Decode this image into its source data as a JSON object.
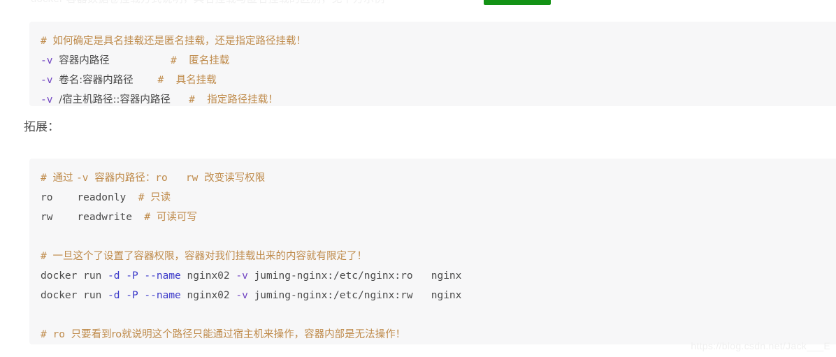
{
  "page": {
    "background_color": "#ffffff",
    "top_clipped_text": "docker 容器数据卷挂载方式说明，具名挂载与匿名挂载的区别，见下方示例",
    "top_green_chip_color": "#139215"
  },
  "colors": {
    "code_background": "#f7f7f8",
    "comment": "#bf8b4b",
    "flag_purple": "#6f42c1",
    "option_blue": "#3b39c9",
    "plain_text": "#4a4a4a",
    "prose_text": "#4f4f4f",
    "watermark": "#f0f0f0"
  },
  "code_block_1": {
    "lines": [
      [
        {
          "text": "# ",
          "type": "comment"
        },
        {
          "text": "如何确定是具名挂载还是匿名挂载，还是指定路径挂载！",
          "type": "comment",
          "cjk": true
        }
      ],
      [
        {
          "text": "-v",
          "type": "flag"
        },
        {
          "text": " ",
          "type": "plain"
        },
        {
          "text": "容器内路径",
          "type": "plain",
          "cjk": true
        },
        {
          "text": "          ",
          "type": "plain"
        },
        {
          "text": "#  ",
          "type": "comment"
        },
        {
          "text": "匿名挂载",
          "type": "comment",
          "cjk": true
        }
      ],
      [
        {
          "text": "-v",
          "type": "flag"
        },
        {
          "text": " ",
          "type": "plain"
        },
        {
          "text": "卷名:容器内路径",
          "type": "plain",
          "cjk": true
        },
        {
          "text": "    ",
          "type": "plain"
        },
        {
          "text": "#  ",
          "type": "comment"
        },
        {
          "text": "具名挂载",
          "type": "comment",
          "cjk": true
        }
      ],
      [
        {
          "text": "-v",
          "type": "flag"
        },
        {
          "text": " ",
          "type": "plain"
        },
        {
          "text": "/宿主机路径::容器内路径",
          "type": "plain",
          "cjk": true
        },
        {
          "text": "   ",
          "type": "plain"
        },
        {
          "text": "#  ",
          "type": "comment"
        },
        {
          "text": "指定路径挂载！",
          "type": "comment",
          "cjk": true
        }
      ]
    ]
  },
  "prose": {
    "extension_label": "拓展："
  },
  "code_block_2": {
    "lines": [
      [
        {
          "text": "# ",
          "type": "comment"
        },
        {
          "text": "通过 ",
          "type": "comment",
          "cjk": true
        },
        {
          "text": "-v ",
          "type": "comment"
        },
        {
          "text": "容器内路径：",
          "type": "comment",
          "cjk": true
        },
        {
          "text": "ro   rw ",
          "type": "comment"
        },
        {
          "text": "改变读写权限",
          "type": "comment",
          "cjk": true
        }
      ],
      [
        {
          "text": "ro    readonly  ",
          "type": "plain"
        },
        {
          "text": "# ",
          "type": "comment"
        },
        {
          "text": "只读",
          "type": "comment",
          "cjk": true
        }
      ],
      [
        {
          "text": "rw    readwrite  ",
          "type": "plain"
        },
        {
          "text": "# ",
          "type": "comment"
        },
        {
          "text": "可读可写",
          "type": "comment",
          "cjk": true
        }
      ],
      [],
      [
        {
          "text": "# ",
          "type": "comment"
        },
        {
          "text": "一旦这个了设置了容器权限，容器对我们挂载出来的内容就有限定了！",
          "type": "comment",
          "cjk": true
        }
      ],
      [
        {
          "text": "docker run ",
          "type": "plain"
        },
        {
          "text": "-d -P --name",
          "type": "opt"
        },
        {
          "text": " nginx02 ",
          "type": "plain"
        },
        {
          "text": "-v",
          "type": "flag"
        },
        {
          "text": " juming-nginx:/etc/nginx:ro   nginx",
          "type": "plain"
        }
      ],
      [
        {
          "text": "docker run ",
          "type": "plain"
        },
        {
          "text": "-d -P --name",
          "type": "opt"
        },
        {
          "text": " nginx02 ",
          "type": "plain"
        },
        {
          "text": "-v",
          "type": "flag"
        },
        {
          "text": " juming-nginx:/etc/nginx:rw   nginx",
          "type": "plain"
        }
      ],
      [],
      [
        {
          "text": "# ro ",
          "type": "comment"
        },
        {
          "text": "只要看到ro就说明这个路径只能通过宿主机来操作，容器内部是无法操作！",
          "type": "comment",
          "cjk": true
        }
      ]
    ]
  },
  "watermark": {
    "text": "https://blog.csdn.net/Jack___E"
  }
}
